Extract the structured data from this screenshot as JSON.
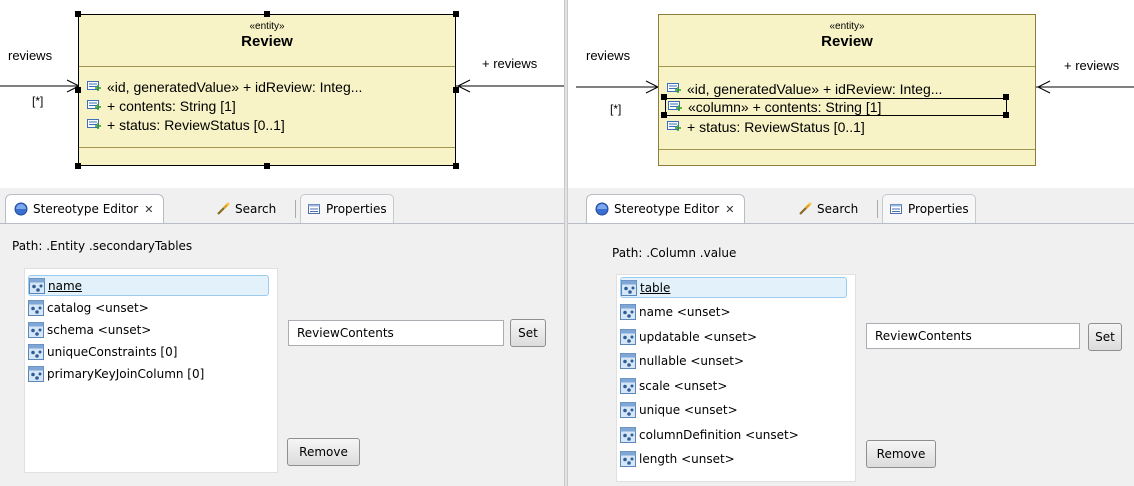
{
  "panels": [
    {
      "diagram": {
        "stereotype": "«entity»",
        "entity_name": "Review",
        "left_association_label": "reviews",
        "left_multiplicity": "[*]",
        "right_association_label": "+ reviews",
        "attributes": [
          {
            "text": "«id, generatedValue» + idReview: Integ..."
          },
          {
            "text": "+ contents: String [1]"
          },
          {
            "text": "+ status: ReviewStatus [0..1]"
          }
        ]
      },
      "editor": {
        "tabs": [
          {
            "label": "Stereotype Editor",
            "close": "✕"
          },
          {
            "label": "Search"
          },
          {
            "label": "Properties"
          }
        ],
        "path": "Path: .Entity .secondaryTables",
        "items": [
          {
            "label": "name"
          },
          {
            "label": "catalog <unset>"
          },
          {
            "label": "schema <unset>"
          },
          {
            "label": "uniqueConstraints [0]"
          },
          {
            "label": "primaryKeyJoinColumn [0]"
          }
        ],
        "value": "ReviewContents",
        "set_label": "Set",
        "remove_label": "Remove"
      }
    },
    {
      "diagram": {
        "stereotype": "«entity»",
        "entity_name": "Review",
        "left_association_label": "reviews",
        "left_multiplicity": "[*]",
        "right_association_label": "+ reviews",
        "attributes": [
          {
            "text": "«id, generatedValue» + idReview: Integ..."
          },
          {
            "text": "«column» + contents: String [1]"
          },
          {
            "text": "+ status: ReviewStatus [0..1]"
          }
        ]
      },
      "editor": {
        "tabs": [
          {
            "label": "Stereotype Editor",
            "close": "✕"
          },
          {
            "label": "Search"
          },
          {
            "label": "Properties"
          }
        ],
        "path": "Path: .Column .value",
        "items": [
          {
            "label": "table"
          },
          {
            "label": "name <unset>"
          },
          {
            "label": "updatable <unset>"
          },
          {
            "label": "nullable <unset>"
          },
          {
            "label": "scale <unset>"
          },
          {
            "label": "unique <unset>"
          },
          {
            "label": "columnDefinition <unset>"
          },
          {
            "label": "length <unset>"
          }
        ],
        "value": "ReviewContents",
        "set_label": "Set",
        "remove_label": "Remove"
      }
    }
  ],
  "colors": {
    "entity_fill": "#f7f3c6",
    "entity_border": "#8c7d3b",
    "selected_item_bg": "#e3f1fb",
    "editor_bg": "#f0f0f0"
  },
  "icons": {
    "attribute": "attribute-icon",
    "stereotype_editor": "stereotype-editor-icon",
    "search": "search-icon",
    "properties": "properties-icon",
    "property_item": "property-icon"
  }
}
